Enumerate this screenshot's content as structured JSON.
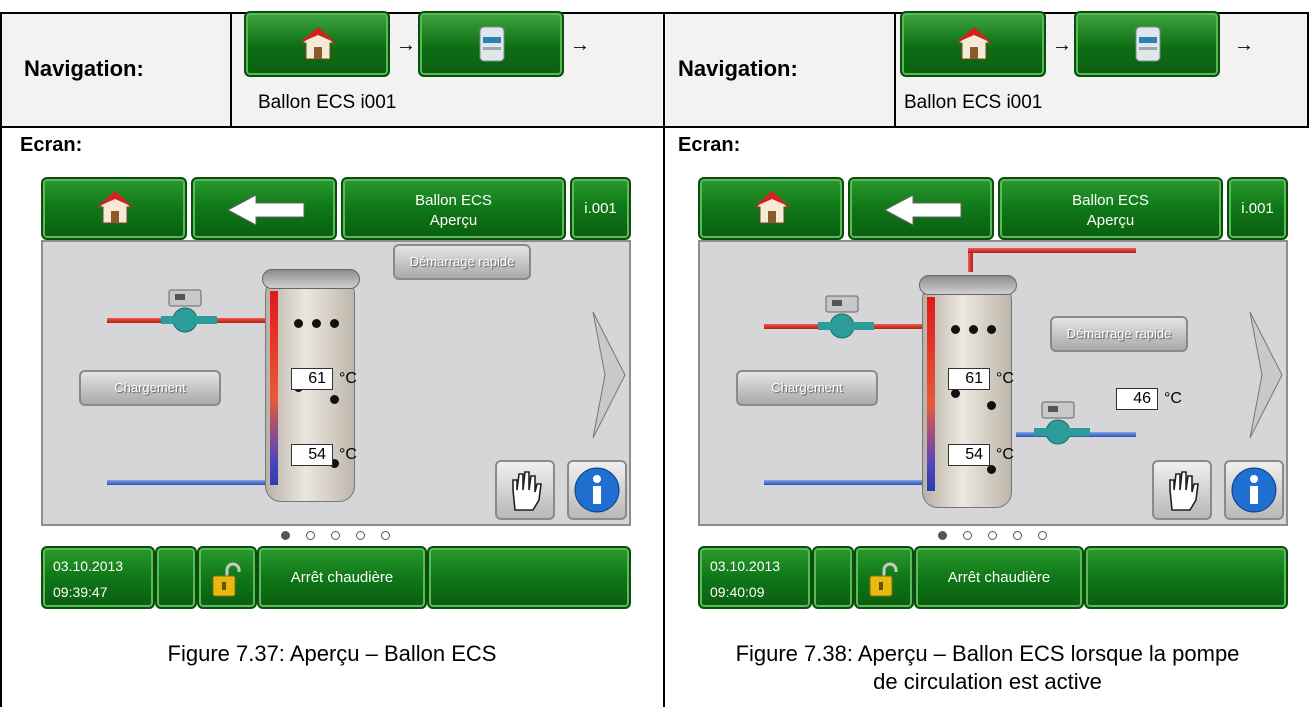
{
  "left": {
    "nav_label": "Navigation:",
    "nav_path": "Ballon ECS i001",
    "arrow": "→",
    "ecran_label": "Ecran:",
    "screen": {
      "title_line1": "Ballon ECS",
      "title_line2": "Aperçu",
      "code": "i.001",
      "quick_start": "Démarrage rapide",
      "charge": "Chargement",
      "temp_top": "61",
      "temp_bottom": "54",
      "unit": "°C",
      "date": "03.10.2013",
      "time": "09:39:47",
      "status": "Arrêt chaudière"
    },
    "caption": "Figure 7.37: Aperçu – Ballon ECS"
  },
  "right": {
    "nav_label": "Navigation:",
    "nav_path": "Ballon ECS i001",
    "arrow": "→",
    "ecran_label": "Ecran:",
    "screen": {
      "title_line1": "Ballon ECS",
      "title_line2": "Aperçu",
      "code": "i.001",
      "quick_start": "Démarrage rapide",
      "charge": "Chargement",
      "temp_top": "61",
      "temp_bottom": "54",
      "temp_circ": "46",
      "unit": "°C",
      "date": "03.10.2013",
      "time": "09:40:09",
      "status": "Arrêt chaudière"
    },
    "caption_line1": "Figure 7.38: Aperçu – Ballon ECS lorsque la pompe",
    "caption_line2": "de circulation est active"
  },
  "icons": [
    "home-icon",
    "boiler-icon",
    "back-arrow-icon",
    "next-arrow-icon",
    "hand-icon",
    "info-icon",
    "padlock-icon",
    "pump-icon"
  ],
  "colors": {
    "green": "#0f7717",
    "panel": "#d6d6d8",
    "hot": "#e01818",
    "cold": "#2a3cb5"
  }
}
